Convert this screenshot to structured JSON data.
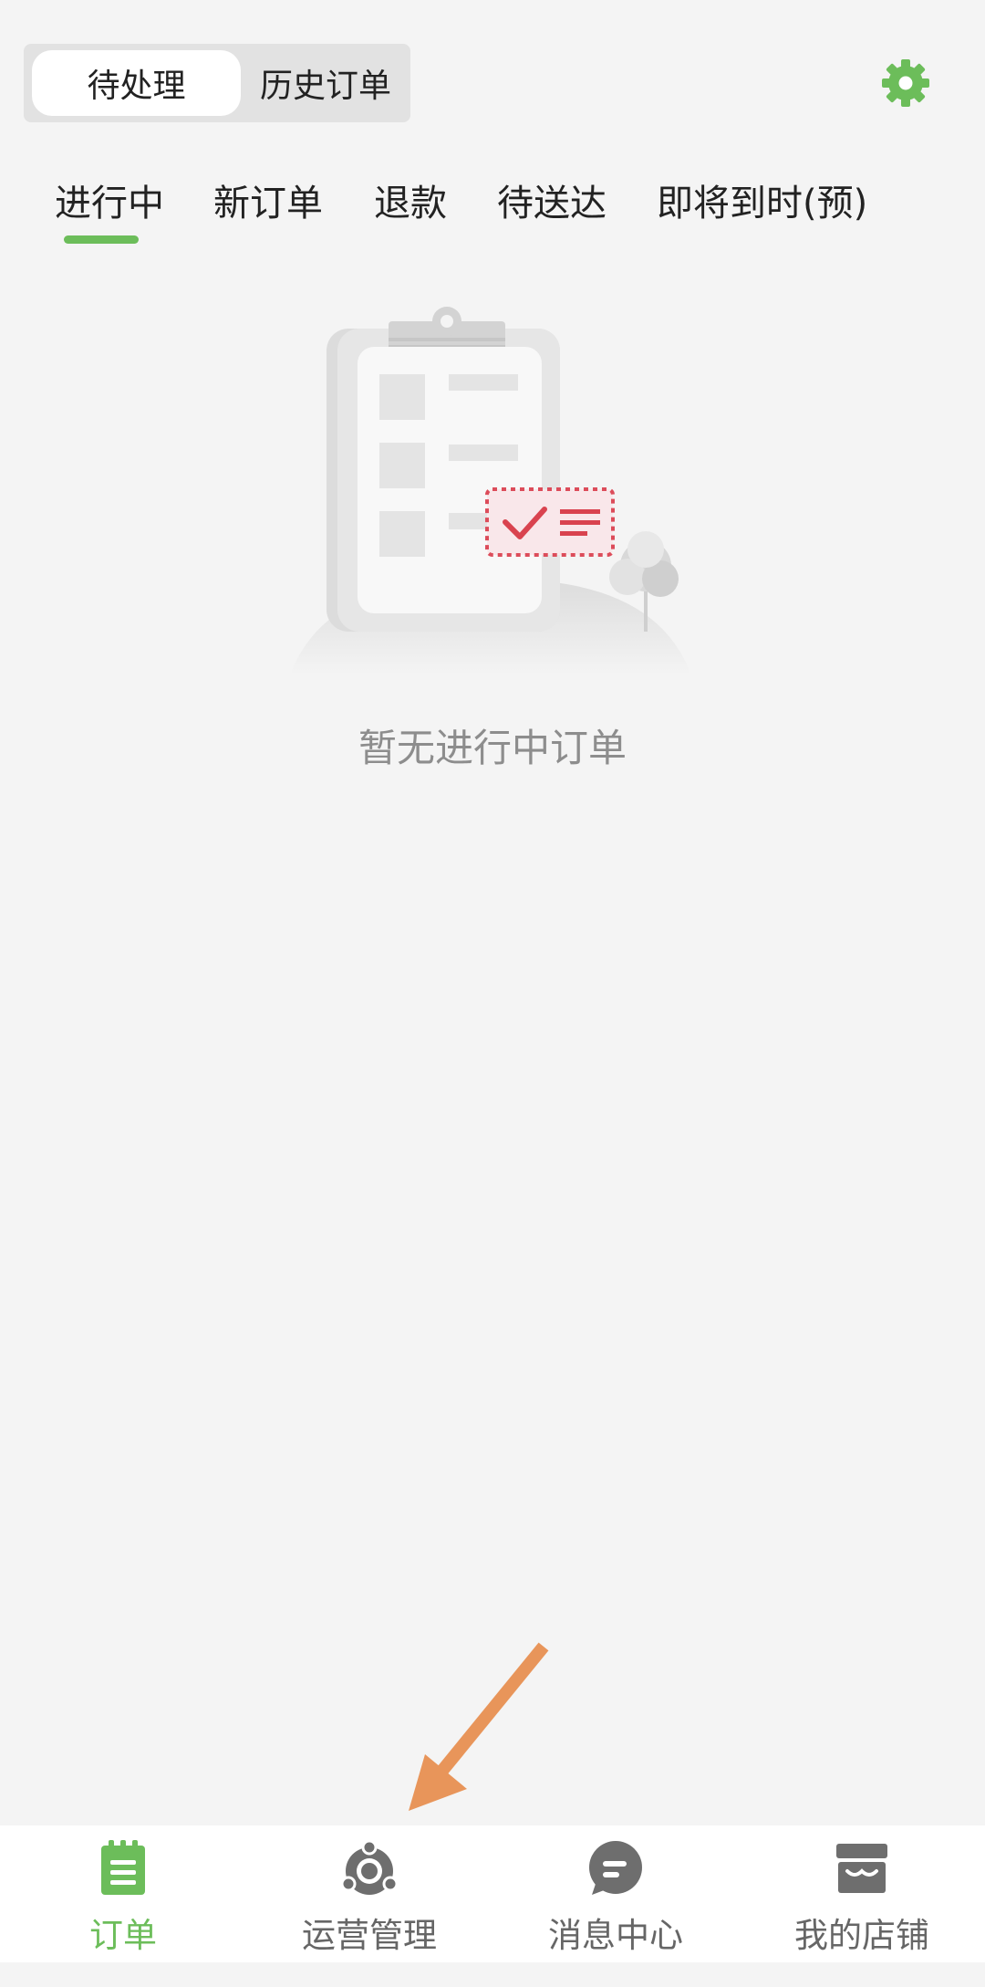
{
  "header": {
    "segments": [
      {
        "label": "待处理",
        "active": true
      },
      {
        "label": "历史订单",
        "active": false
      }
    ],
    "settings_icon": "gear-icon",
    "accent_color": "#6cbd5a"
  },
  "tabs": [
    {
      "label": "进行中",
      "active": true
    },
    {
      "label": "新订单",
      "active": false
    },
    {
      "label": "退款",
      "active": false
    },
    {
      "label": "待送达",
      "active": false
    },
    {
      "label": "即将到时(预)",
      "active": false
    }
  ],
  "empty_state": {
    "message": "暂无进行中订单",
    "illustration": "clipboard-empty-illustration"
  },
  "bottom_nav": [
    {
      "label": "订单",
      "icon": "order-icon",
      "active": true
    },
    {
      "label": "运营管理",
      "icon": "operations-icon",
      "active": false
    },
    {
      "label": "消息中心",
      "icon": "message-icon",
      "active": false
    },
    {
      "label": "我的店铺",
      "icon": "store-icon",
      "active": false
    }
  ],
  "annotation": {
    "arrow_color": "#e8955a"
  }
}
